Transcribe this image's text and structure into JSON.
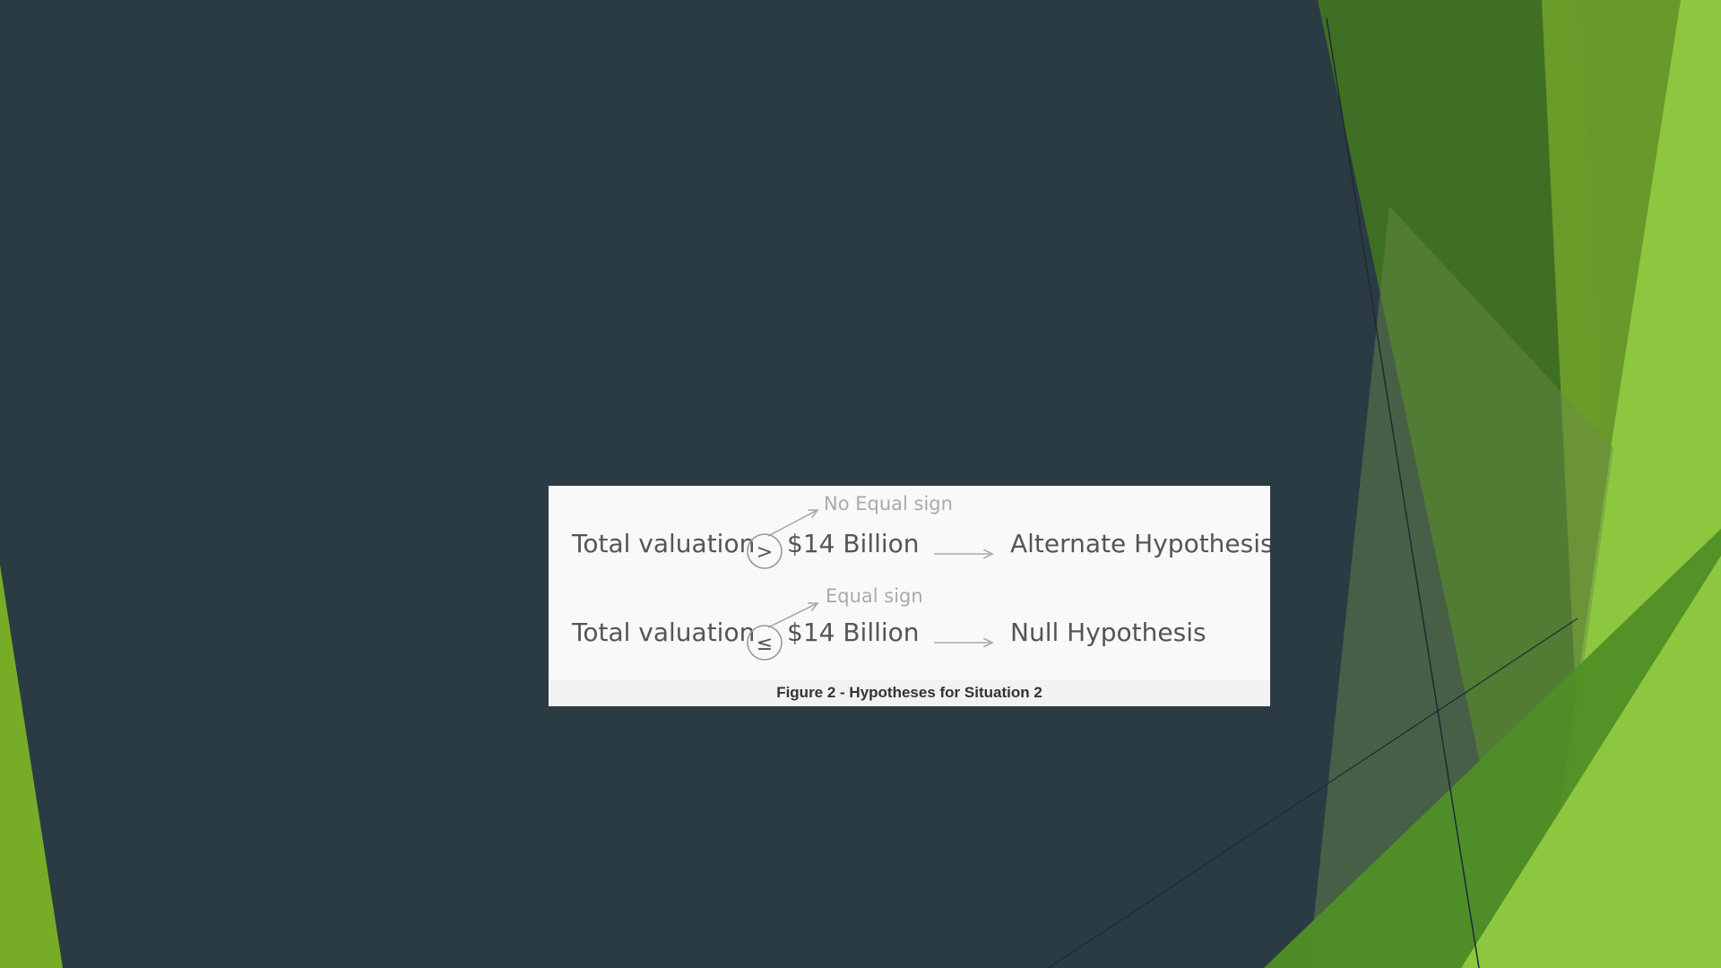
{
  "figure": {
    "row1": {
      "annotation": "No Equal sign",
      "left": "Total valuation",
      "symbol": ">",
      "amount": "$14 Billion",
      "result": "Alternate Hypothesis"
    },
    "row2": {
      "annotation": "Equal sign",
      "left": "Total valuation",
      "symbol": "≤",
      "amount": "$14 Billion",
      "result": "Null Hypothesis"
    },
    "caption": "Figure 2 - Hypotheses for Situation 2"
  },
  "colors": {
    "background": "#2b3b44",
    "accent_dark_green": "#3f6f24",
    "accent_green": "#77ac27",
    "accent_light_green": "#8dc63f"
  }
}
